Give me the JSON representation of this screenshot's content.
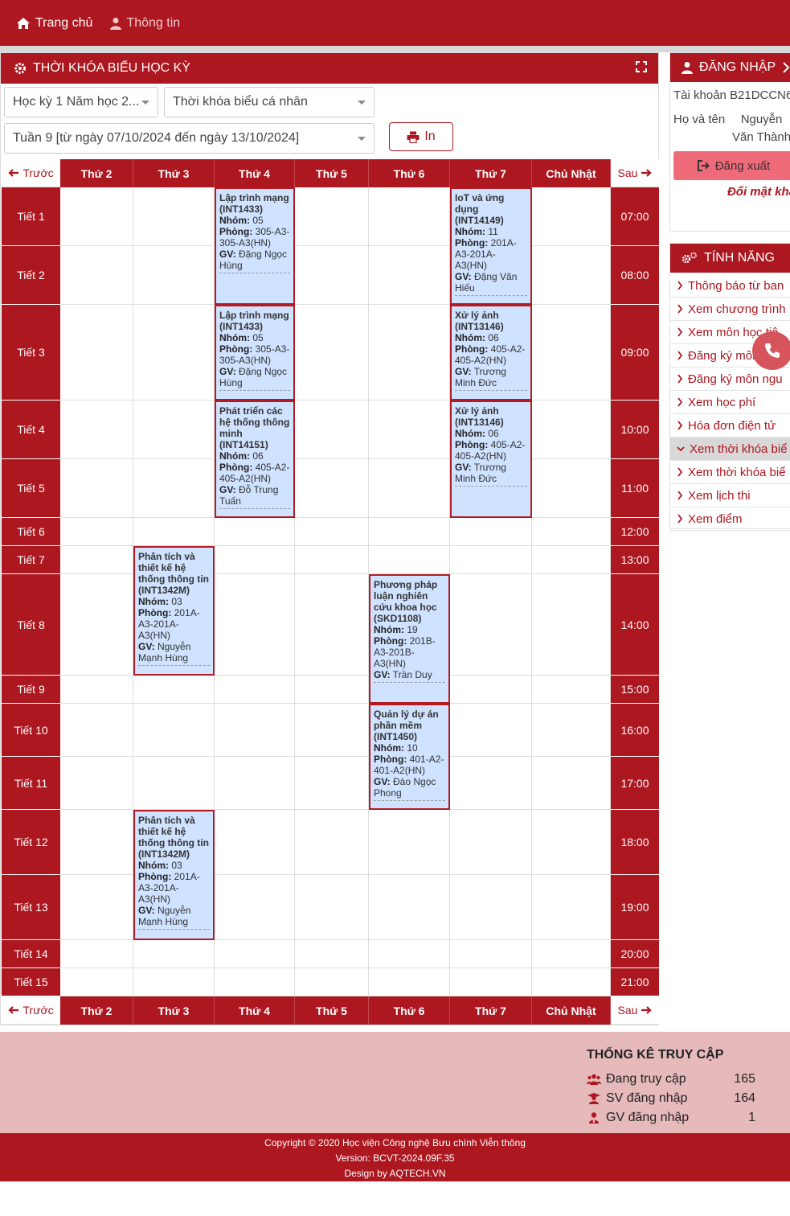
{
  "topnav": {
    "home_label": "Trang chủ",
    "info_label": "Thông tin"
  },
  "panel": {
    "title": "THỜI KHÓA BIỂU HỌC KỲ"
  },
  "filters": {
    "semester": "Học kỳ 1 Năm học 2...",
    "schedule_type": "Thời khóa biểu cá nhân",
    "week": "Tuần 9 [từ ngày 07/10/2024 đến ngày 13/10/2024]",
    "print_label": "In"
  },
  "timetable": {
    "prev_label": "Trước",
    "next_label": "Sau",
    "days": [
      "Thứ 2",
      "Thứ 3",
      "Thứ 4",
      "Thứ 5",
      "Thứ 6",
      "Thứ 7",
      "Chủ Nhật"
    ],
    "periods": [
      {
        "label": "Tiết 1",
        "time": "07:00"
      },
      {
        "label": "Tiết 2",
        "time": "08:00"
      },
      {
        "label": "Tiết 3",
        "time": "09:00"
      },
      {
        "label": "Tiết 4",
        "time": "10:00"
      },
      {
        "label": "Tiết 5",
        "time": "11:00"
      },
      {
        "label": "Tiết 6",
        "time": "12:00"
      },
      {
        "label": "Tiết 7",
        "time": "13:00"
      },
      {
        "label": "Tiết 8",
        "time": "14:00"
      },
      {
        "label": "Tiết 9",
        "time": "15:00"
      },
      {
        "label": "Tiết 10",
        "time": "16:00"
      },
      {
        "label": "Tiết 11",
        "time": "17:00"
      },
      {
        "label": "Tiết 12",
        "time": "18:00"
      },
      {
        "label": "Tiết 13",
        "time": "19:00"
      },
      {
        "label": "Tiết 14",
        "time": "20:00"
      },
      {
        "label": "Tiết 15",
        "time": "21:00"
      }
    ],
    "field_labels": {
      "group": "Nhóm:",
      "room": "Phòng:",
      "teacher": "GV:"
    },
    "courses": [
      {
        "day": 2,
        "start": 0,
        "end": 1,
        "title": "Lập trình mạng (INT1433)",
        "group": "05",
        "room": "305-A3-305-A3(HN)",
        "teacher": "Đặng Ngọc Hùng"
      },
      {
        "day": 2,
        "start": 2,
        "end": 2,
        "title": "Lập trình mạng (INT1433)",
        "group": "05",
        "room": "305-A3-305-A3(HN)",
        "teacher": "Đặng Ngọc Hùng"
      },
      {
        "day": 2,
        "start": 3,
        "end": 4,
        "title": "Phát triển các hệ thống thông minh (INT14151)",
        "group": "06",
        "room": "405-A2-405-A2(HN)",
        "teacher": "Đỗ Trung Tuấn"
      },
      {
        "day": 5,
        "start": 0,
        "end": 1,
        "title": "IoT và ứng dụng (INT14149)",
        "group": "11",
        "room": "201A-A3-201A-A3(HN)",
        "teacher": "Đặng Văn Hiếu"
      },
      {
        "day": 5,
        "start": 2,
        "end": 2,
        "title": "Xử lý ảnh (INT13146)",
        "group": "06",
        "room": "405-A2-405-A2(HN)",
        "teacher": "Trương Minh Đức"
      },
      {
        "day": 5,
        "start": 3,
        "end": 4,
        "title": "Xử lý ảnh (INT13146)",
        "group": "06",
        "room": "405-A2-405-A2(HN)",
        "teacher": "Trương Minh Đức"
      },
      {
        "day": 1,
        "start": 6,
        "end": 7,
        "title": "Phân tích và thiết kế hệ thống thông tin (INT1342M)",
        "group": "03",
        "room": "201A-A3-201A-A3(HN)",
        "teacher": "Nguyễn Mạnh Hùng"
      },
      {
        "day": 4,
        "start": 7,
        "end": 8,
        "title": "Phương pháp luận nghiên cứu khoa học (SKD1108)",
        "group": "19",
        "room": "201B-A3-201B-A3(HN)",
        "teacher": "Trần Duy"
      },
      {
        "day": 4,
        "start": 9,
        "end": 10,
        "title": "Quản lý dự án phần mềm (INT1450)",
        "group": "10",
        "room": "401-A2-401-A2(HN)",
        "teacher": "Đào Ngọc Phong"
      },
      {
        "day": 1,
        "start": 11,
        "end": 12,
        "title": "Phân tích và thiết kế hệ thống thông tin (INT1342M)",
        "group": "03",
        "room": "201A-A3-201A-A3(HN)",
        "teacher": "Nguyễn Mạnh Hùng"
      }
    ]
  },
  "login_box": {
    "title": "ĐĂNG NHẬP",
    "account_label": "Tài khoản",
    "account_value": "B21DCCN6",
    "name_label": "Họ và tên",
    "name_value": "Nguyễn Văn Thành",
    "logout_label": "Đăng xuất",
    "change_password": "Đổi mật khẩ"
  },
  "features": {
    "title": "TÍNH NĂNG",
    "items": [
      {
        "label": "Thông báo từ ban",
        "active": false
      },
      {
        "label": "Xem chương trình",
        "active": false
      },
      {
        "label": "Xem môn học tiê",
        "active": false
      },
      {
        "label": "Đăng ký môn học",
        "active": false
      },
      {
        "label": "Đăng ký môn ngu",
        "active": false
      },
      {
        "label": "Xem học phí",
        "active": false
      },
      {
        "label": "Hóa đơn điện tử",
        "active": false
      },
      {
        "label": "Xem thời khóa biể",
        "active": true
      },
      {
        "label": "Xem thời khóa biể",
        "active": false
      },
      {
        "label": "Xem lịch thi",
        "active": false
      },
      {
        "label": "Xem điểm",
        "active": false
      }
    ]
  },
  "stats": {
    "title": "THỐNG KÊ TRUY CẬP",
    "rows": [
      {
        "label": "Đang truy cập",
        "value": "165"
      },
      {
        "label": "SV đăng nhập",
        "value": "164"
      },
      {
        "label": "GV đăng nhập",
        "value": "1"
      }
    ]
  },
  "footer": {
    "copyright": "Copyright © 2020 Học viện Công nghệ Bưu chính Viễn thông",
    "version": "Version: BCVT-2024.09F.35",
    "design": "Design by AQTECH.VN"
  },
  "colors": {
    "brand_red": "#ac1720",
    "course_bg": "#cfe2ff",
    "stats_bg": "#e6b9bb"
  }
}
